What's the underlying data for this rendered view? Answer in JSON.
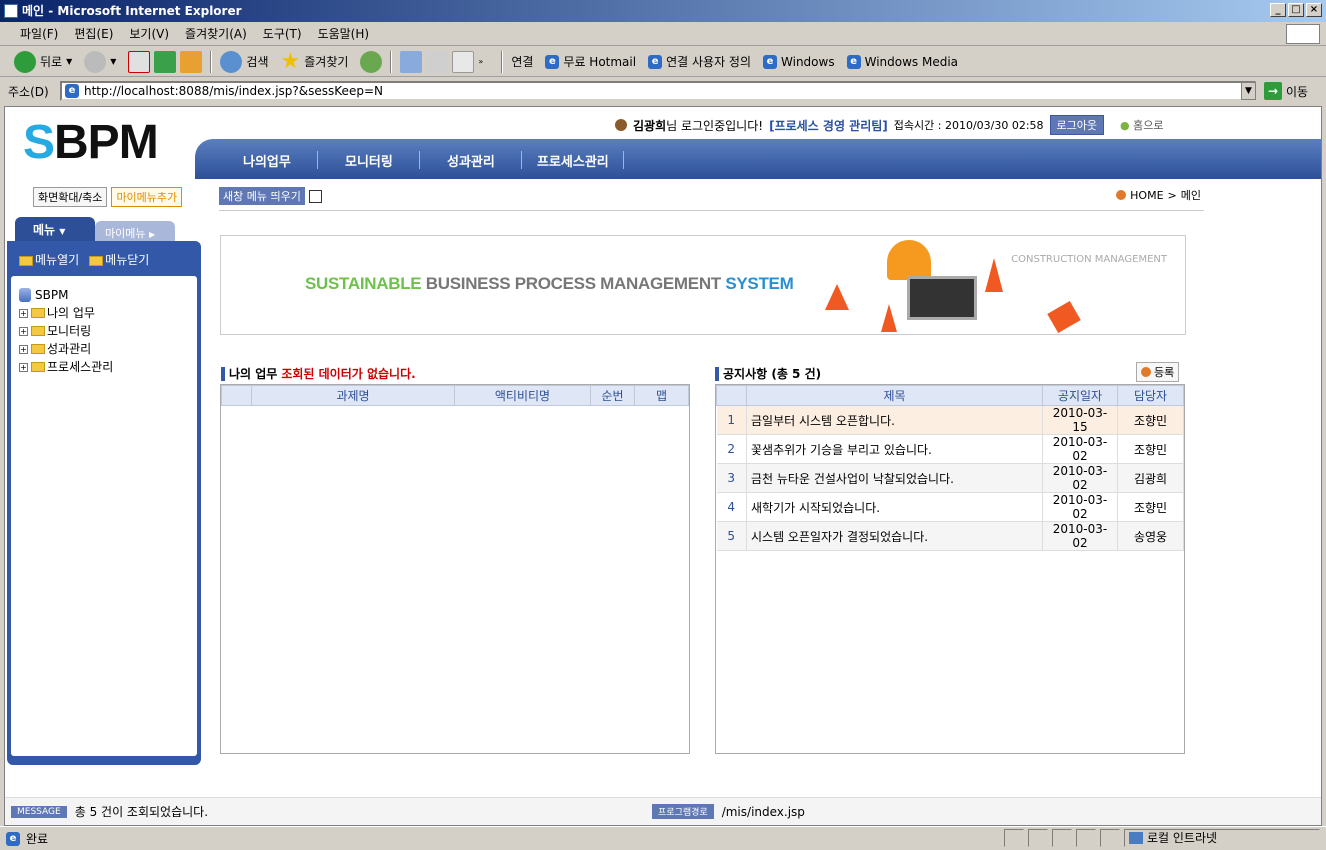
{
  "window": {
    "title": "메인 - Microsoft Internet Explorer"
  },
  "menubar": [
    "파일(F)",
    "편집(E)",
    "보기(V)",
    "즐겨찾기(A)",
    "도구(T)",
    "도움말(H)"
  ],
  "toolbar": {
    "back": "뒤로",
    "search": "검색",
    "favorites": "즐겨찾기",
    "links_label": "연결",
    "links": [
      "무료 Hotmail",
      "연결 사용자 정의",
      "Windows",
      "Windows Media"
    ]
  },
  "address": {
    "label": "주소(D)",
    "url": "http://localhost:8088/mis/index.jsp?&sessKeep=N",
    "go": "이동"
  },
  "status": {
    "text": "완료",
    "zone": "로컬 인트라넷"
  },
  "page": {
    "logo_s": "S",
    "logo_rest": "BPM",
    "user": {
      "name": "김광희",
      "suffix": "님 로그인중입니다!",
      "role": "[프로세스 경영 관리팀]",
      "access": "접속시간 : 2010/03/30 02:58",
      "logout": "로그아웃",
      "home": "홈으로"
    },
    "nav": [
      "나의업무",
      "모니터링",
      "성과관리",
      "프로세스관리"
    ],
    "zoom_btn": "화면확대/축소",
    "mymenu_add": "마이메뉴추가",
    "newwin_label": "새창 메뉴 띄우기",
    "breadcrumb": {
      "home": "HOME",
      "sep": ">",
      "current": "메인"
    },
    "menu_tab": "메뉴",
    "mymenu_tab": "마이메뉴",
    "open_menu": "메뉴열기",
    "close_menu": "메뉴닫기",
    "tree": [
      "SBPM",
      "나의 업무",
      "모니터링",
      "성과관리",
      "프로세스관리"
    ],
    "banner": {
      "w1": "SUSTAINABLE",
      "w2": "BUSINESS PROCESS MANAGEMENT",
      "w3": "SYSTEM",
      "corner": "CONSTRUCTION MANAGEMENT"
    },
    "mywork": {
      "title": "나의 업무",
      "msg": "조회된 데이터가 없습니다.",
      "columns": [
        "",
        "과제명",
        "액티비티명",
        "순번",
        "맵"
      ]
    },
    "notice": {
      "title": "공지사항 (총 5 건)",
      "register": "등록",
      "columns": [
        "",
        "제목",
        "공지일자",
        "담당자"
      ],
      "rows": [
        {
          "no": "1",
          "title": "금일부터 시스템 오픈합니다.",
          "date": "2010-03-15",
          "owner": "조향민"
        },
        {
          "no": "2",
          "title": "꽃샘추위가 기승을 부리고 있습니다.",
          "date": "2010-03-02",
          "owner": "조향민"
        },
        {
          "no": "3",
          "title": "금천 뉴타운 건설사업이 낙찰되었습니다.",
          "date": "2010-03-02",
          "owner": "김광희"
        },
        {
          "no": "4",
          "title": "새학기가 시작되었습니다.",
          "date": "2010-03-02",
          "owner": "조향민"
        },
        {
          "no": "5",
          "title": "시스템 오픈일자가 결정되었습니다.",
          "date": "2010-03-02",
          "owner": "송영웅"
        }
      ]
    },
    "footer": {
      "msg_tag": "MESSAGE",
      "msg": "총 5 건이 조회되었습니다.",
      "path_tag": "프로그램경로",
      "path": "/mis/index.jsp"
    }
  },
  "colors": {
    "accent": "#2c4f98",
    "logo_s": "#27a9e1",
    "error": "#cc0000",
    "highlight_row": "#fdeee2"
  }
}
